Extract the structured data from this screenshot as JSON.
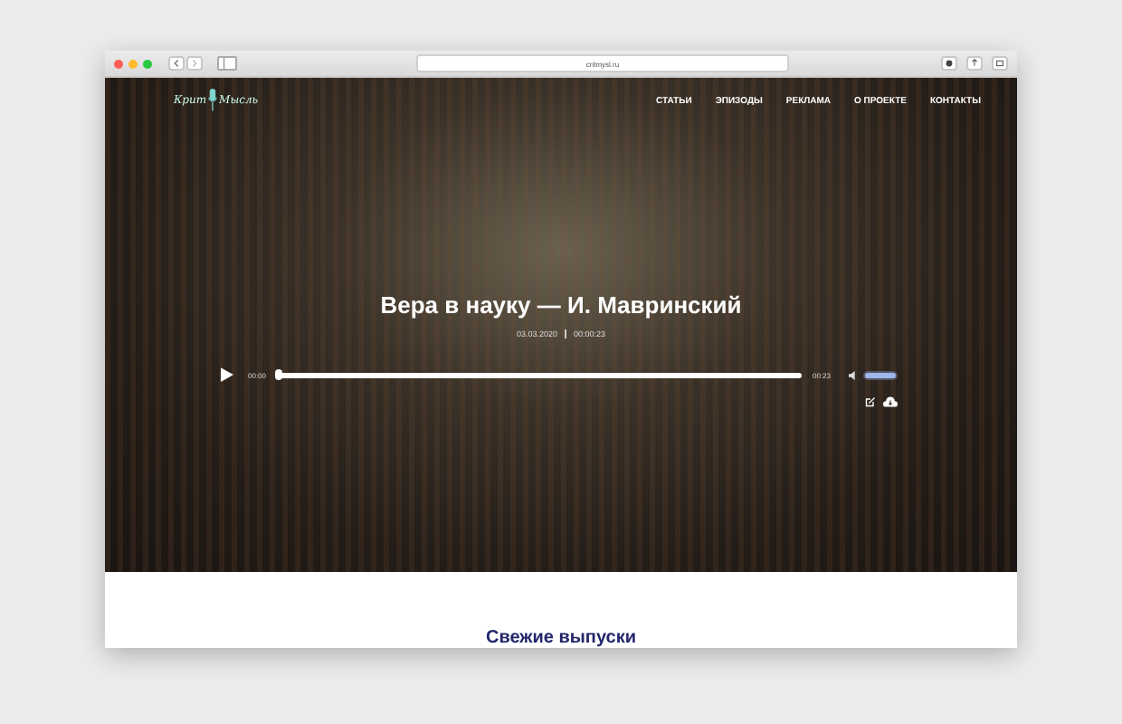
{
  "browser": {
    "url": "critmysl.ru"
  },
  "site": {
    "logo_words": [
      "Крит",
      "Мысль"
    ],
    "nav": [
      "СТАТЬИ",
      "ЭПИЗОДЫ",
      "РЕКЛАМА",
      "О ПРОЕКТЕ",
      "КОНТАКТЫ"
    ]
  },
  "episode": {
    "title": "Вера в науку — И. Мавринский",
    "date": "03.03.2020",
    "duration": "00:00:23",
    "player": {
      "current_time": "00:00",
      "total_time": "00:23",
      "level": 0,
      "volume": {
        "level": 1
      }
    }
  },
  "section_heading": "Свежие выпуски"
}
